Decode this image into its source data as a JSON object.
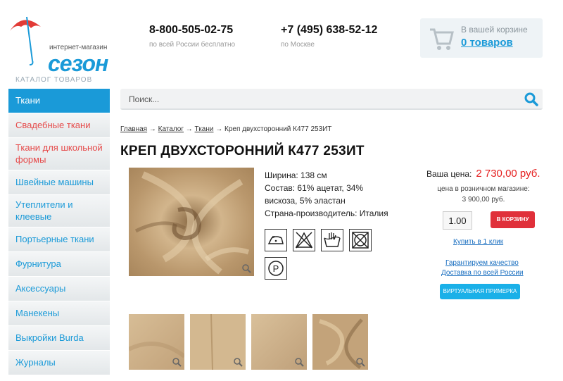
{
  "header": {
    "logo_tagline": "интернет-магазин",
    "logo_name": "сезон",
    "catalog_title": "КАТАЛОГ ТОВАРОВ",
    "phones": [
      {
        "number": "8-800-505-02-75",
        "note": "по всей России бесплатно"
      },
      {
        "number": "+7 (495) 638-52-12",
        "note": "по Москве"
      }
    ],
    "cart": {
      "label": "В вашей корзине",
      "count": "0 товаров"
    }
  },
  "sidebar": {
    "items": [
      {
        "label": "Ткани"
      },
      {
        "label": "Свадебные ткани"
      },
      {
        "label": "Ткани для школьной формы"
      },
      {
        "label": "Швейные машины"
      },
      {
        "label": "Утеплители и клеевые"
      },
      {
        "label": "Портьерные ткани"
      },
      {
        "label": "Фурнитура"
      },
      {
        "label": "Аксессуары"
      },
      {
        "label": "Манекены"
      },
      {
        "label": "Выкройки Burda"
      },
      {
        "label": "Журналы"
      }
    ]
  },
  "search": {
    "placeholder": "Поиск..."
  },
  "breadcrumb": {
    "items": [
      "Главная",
      "Каталог",
      "Ткани"
    ],
    "separator": "→",
    "current": "Креп двухсторонний К477 253ИТ"
  },
  "product": {
    "title": "КРЕП ДВУХСТОРОННИЙ К477 253ИТ",
    "specs": [
      "Ширина: 138 см",
      "Состав: 61% ацетат, 34% вискоза, 5% эластан",
      "Страна-производитель: Италия"
    ],
    "care_icons": [
      "iron-low-icon",
      "no-bleach-icon",
      "hand-wash-icon",
      "no-tumble-dry-icon",
      "professional-clean-p-icon"
    ],
    "care_p_letter": "P",
    "price_label": "Ваша цена:",
    "price": "2 730,00 руб.",
    "retail_label": "цена в розничном магазине:",
    "retail_price": "3 900,00 руб.",
    "quantity": "1.00",
    "add_to_cart": "В КОРЗИНУ",
    "one_click": "Купить в 1 клик",
    "quality_link": "Гарантируем качество",
    "delivery_link": "Доставка по всей России",
    "try_on": "ВИРТУАЛЬНАЯ ПРИМЕРКА"
  },
  "colors": {
    "accent": "#1a9ad8",
    "price": "#e51d1d",
    "cart_button": "#e0303a",
    "fabric": "#c9ab82"
  }
}
